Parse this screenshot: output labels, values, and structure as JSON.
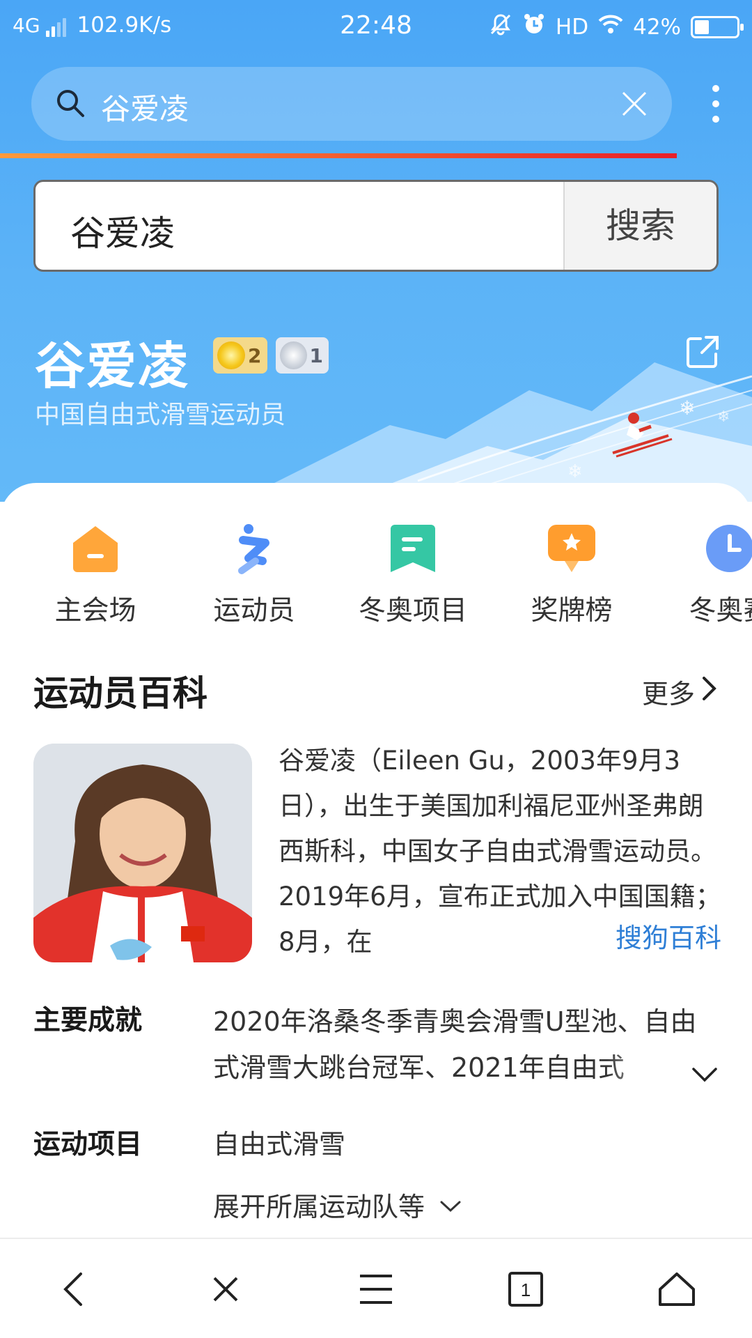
{
  "status_bar": {
    "network": "4G",
    "speed": "102.9K/s",
    "time": "22:48",
    "hd": "HD",
    "battery": "42%"
  },
  "address_bar": {
    "query": "谷爱凌"
  },
  "page_search": {
    "query": "谷爱凌",
    "button": "搜索"
  },
  "hero": {
    "name": "谷爱凌",
    "gold_count": "2",
    "silver_count": "1",
    "subtitle": "中国自由式滑雪运动员"
  },
  "nav": [
    {
      "label": "主会场",
      "icon": "main-venue-icon",
      "color": "#ffa63a"
    },
    {
      "label": "运动员",
      "icon": "athlete-icon",
      "color": "#4f8df7"
    },
    {
      "label": "冬奥项目",
      "icon": "events-icon",
      "color": "#35c7a4"
    },
    {
      "label": "奖牌榜",
      "icon": "medal-table-icon",
      "color": "#ff9d2e"
    },
    {
      "label": "冬奥赛",
      "icon": "schedule-icon",
      "color": "#6a9cf7"
    }
  ],
  "encyclopedia": {
    "title": "运动员百科",
    "more": "更多",
    "bio": "谷爱凌（Eileen Gu，2003年9月3日），出生于美国加利福尼亚州圣弗朗西斯科，中国女子自由式滑雪运动员。2019年6月，宣布正式加入中国国籍；8月，在",
    "source": "搜狗百科"
  },
  "details": {
    "achievements_label": "主要成就",
    "achievements_value": "2020年洛桑冬季青奥会滑雪U型池、自由式滑雪大跳台冠军、2021年自由式",
    "sport_label": "运动项目",
    "sport_value": "自由式滑雪",
    "expand": "展开所属运动队等"
  },
  "toolbar": {
    "tab_count": "1"
  }
}
